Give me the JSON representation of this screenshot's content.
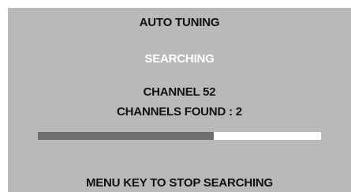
{
  "screen": {
    "title": "AUTO TUNING",
    "status": "SEARCHING",
    "channel_line": "CHANNEL 52",
    "channels_found_line": "CHANNELS FOUND : 2",
    "progress_percent": 62,
    "hint": "MENU KEY TO STOP SEARCHING"
  },
  "colors": {
    "screen_background": "#b9b9b9",
    "progress_fill": "#6f6f6f",
    "progress_track": "#ffffff",
    "status_text": "#ffffff",
    "text": "#111111"
  }
}
